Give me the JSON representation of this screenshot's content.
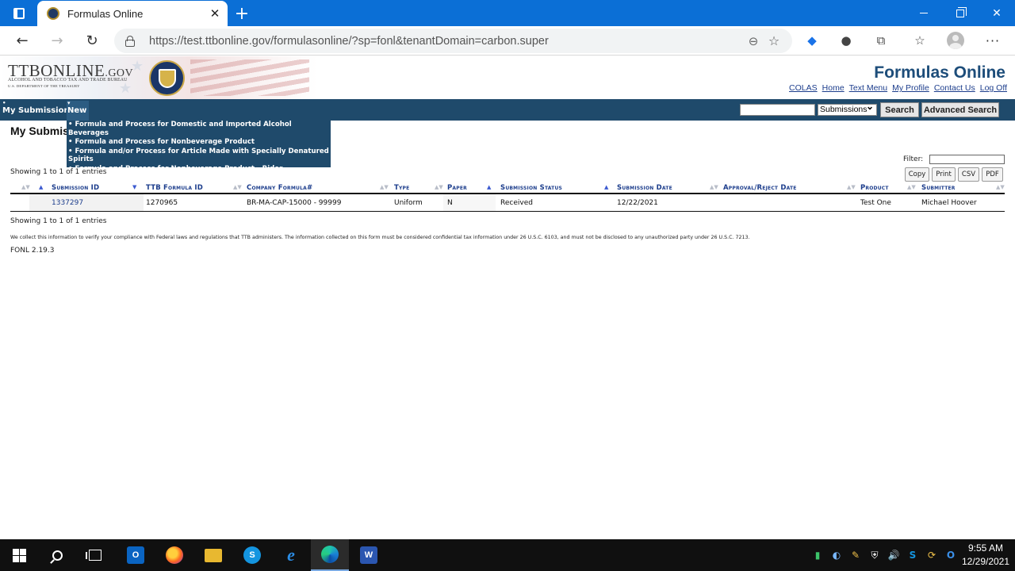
{
  "browser": {
    "tab_title": "Formulas Online",
    "tab_close": "✕",
    "new_tab": "+",
    "url": "https://test.ttbonline.gov/formulasonline/?sp=fonl&tenantDomain=carbon.super",
    "icons": {
      "back": "←",
      "forward": "→",
      "reload": "↻",
      "zoom": "⊖",
      "favorite_add": "☆",
      "favorites": "☆",
      "extensions": "⧉",
      "menu": "···",
      "minimize": "",
      "close": "✕"
    }
  },
  "header": {
    "logo_main": "TTBONLINE",
    "logo_gov": ".GOV",
    "logo_sub1": "ALCOHOL AND TOBACCO TAX AND TRADE BUREAU",
    "logo_sub2": "U.S. DEPARTMENT OF THE TREASURY",
    "site_title": "Formulas Online",
    "links": [
      "COLAS",
      "Home",
      "Text Menu",
      "My Profile",
      "Contact Us",
      "Log Off"
    ]
  },
  "nav": {
    "bullet": "•",
    "new_marker": "▾",
    "my_submissions": "My Submissions",
    "new": "New",
    "search_value": "",
    "search_scope": "Submissions",
    "search_button": "Search",
    "advanced_button": "Advanced Search"
  },
  "dropdown": {
    "items": [
      "• Formula and Process for Domestic and Imported Alcohol Beverages",
      "• Formula and Process for Nonbeverage Product",
      "• Formula and/or Process for Article Made with Specially Denatured Spirits",
      "• Formula and Process for Nonbeverage Product - Rider"
    ]
  },
  "main": {
    "page_title": "My Submissions",
    "info_top": "Showing 1 to 1 of 1 entries",
    "info_bottom": "Showing 1 to 1 of 1 entries",
    "filter_label": "Filter:",
    "filter_value": "",
    "export_buttons": [
      "Copy",
      "Print",
      "CSV",
      "PDF"
    ],
    "columns": [
      "Submission ID",
      "TTB Formula ID",
      "Company Formula#",
      "Type",
      "Paper",
      "Submission Status",
      "Submission Date",
      "Approval/Reject Date",
      "Product",
      "Submitter"
    ],
    "sort_icons": {
      "both": "▲▼",
      "up": "▲",
      "down": "▼"
    },
    "rows": [
      {
        "submission_id": "1337297",
        "ttb_formula_id": "1270965",
        "company_formula": "BR-MA-CAP-15000 - 99999",
        "type": "Uniform",
        "paper": "N",
        "status": "Received",
        "submission_date": "12/22/2021",
        "approval_date": "",
        "product": "Test One",
        "submitter": "Michael Hoover"
      }
    ],
    "disclaimer": "We collect this information to verify your compliance with Federal laws and regulations that TTB administers. The information collected on this form must be considered confidential tax information under 26 U.S.C. 6103, and must not be disclosed to any unauthorized party under 26 U.S.C. 7213.",
    "version": "FONL 2.19.3"
  },
  "taskbar": {
    "apps": [
      "outlook",
      "firefox",
      "file-explorer",
      "skype",
      "internet-explorer",
      "edge",
      "word"
    ],
    "outlook_letter": "O",
    "skype_letter": "S",
    "ie_letter": "e",
    "word_letter": "W",
    "tray_icons": {
      "battery": "▮",
      "c": "◐",
      "pen": "✎",
      "shield": "⛨",
      "volume": "🔊",
      "skype": "S",
      "sync": "⟳",
      "outlook": "O"
    },
    "time": "9:55 AM",
    "date": "12/29/2021"
  },
  "colors": {
    "titlebar": "#0b6fd6",
    "navbar": "#1f4a6b",
    "title_blue": "#1d4d7a",
    "link_blue": "#1c3d8c"
  }
}
